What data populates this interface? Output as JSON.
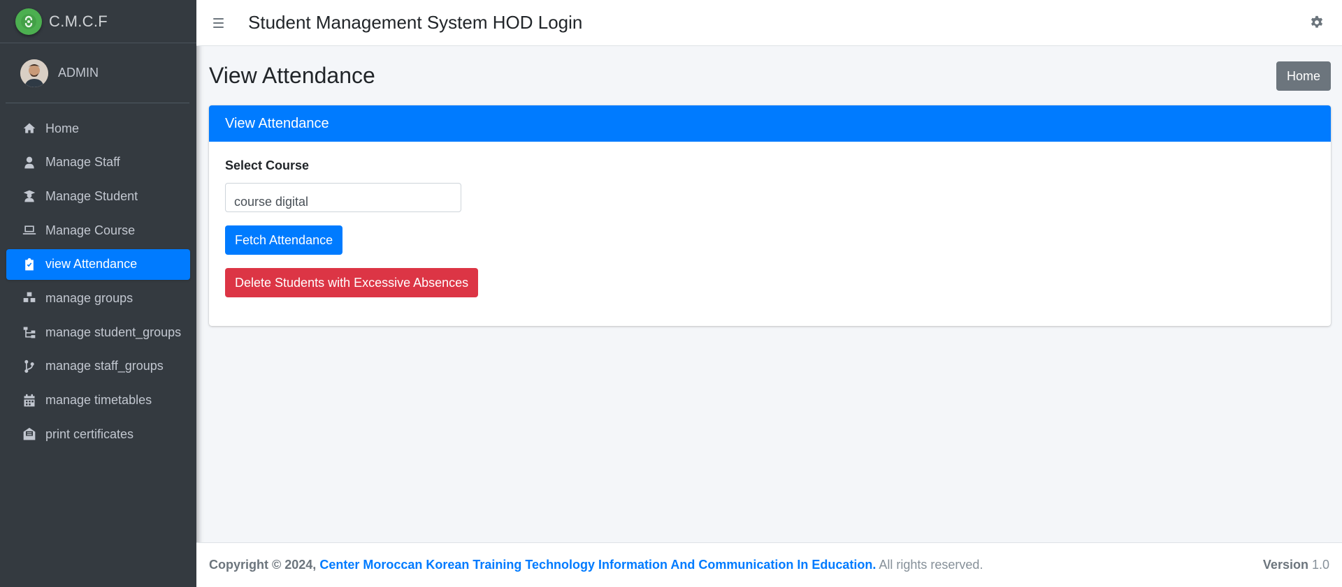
{
  "brand": {
    "name": "C.M.C.F",
    "logo_icon": "brand-logo-icon"
  },
  "user": {
    "name": "ADMIN"
  },
  "sidebar": {
    "items": [
      {
        "label": "Home",
        "icon": "home-icon"
      },
      {
        "label": "Manage Staff",
        "icon": "user-tie-icon"
      },
      {
        "label": "Manage Student",
        "icon": "graduate-icon"
      },
      {
        "label": "Manage Course",
        "icon": "laptop-icon"
      },
      {
        "label": "view Attendance",
        "icon": "clipboard-check-icon",
        "active": true
      },
      {
        "label": "manage groups",
        "icon": "cubes-icon"
      },
      {
        "label": "manage student_groups",
        "icon": "sitemap-icon"
      },
      {
        "label": "manage staff_groups",
        "icon": "code-branch-icon"
      },
      {
        "label": "manage timetables",
        "icon": "calendar-icon"
      },
      {
        "label": "print certificates",
        "icon": "envelope-open-text-icon"
      }
    ]
  },
  "header": {
    "title": "Student Management System HOD Login"
  },
  "page": {
    "title": "View Attendance",
    "home_button": "Home"
  },
  "card": {
    "title": "View Attendance",
    "select_label": "Select Course",
    "select_value": "course digital",
    "fetch_button": "Fetch Attendance",
    "delete_button": "Delete Students with Excessive Absences"
  },
  "footer": {
    "copyright_prefix": "Copyright © 2024,",
    "organization": "Center Moroccan Korean Training Technology Information And Communication In Education.",
    "rights": "All rights reserved.",
    "version_label": "Version",
    "version_value": "1.0"
  },
  "colors": {
    "sidebar_bg": "#343a40",
    "primary": "#007bff",
    "danger": "#dc3545",
    "secondary": "#6c757d",
    "content_bg": "#f4f6f9"
  }
}
